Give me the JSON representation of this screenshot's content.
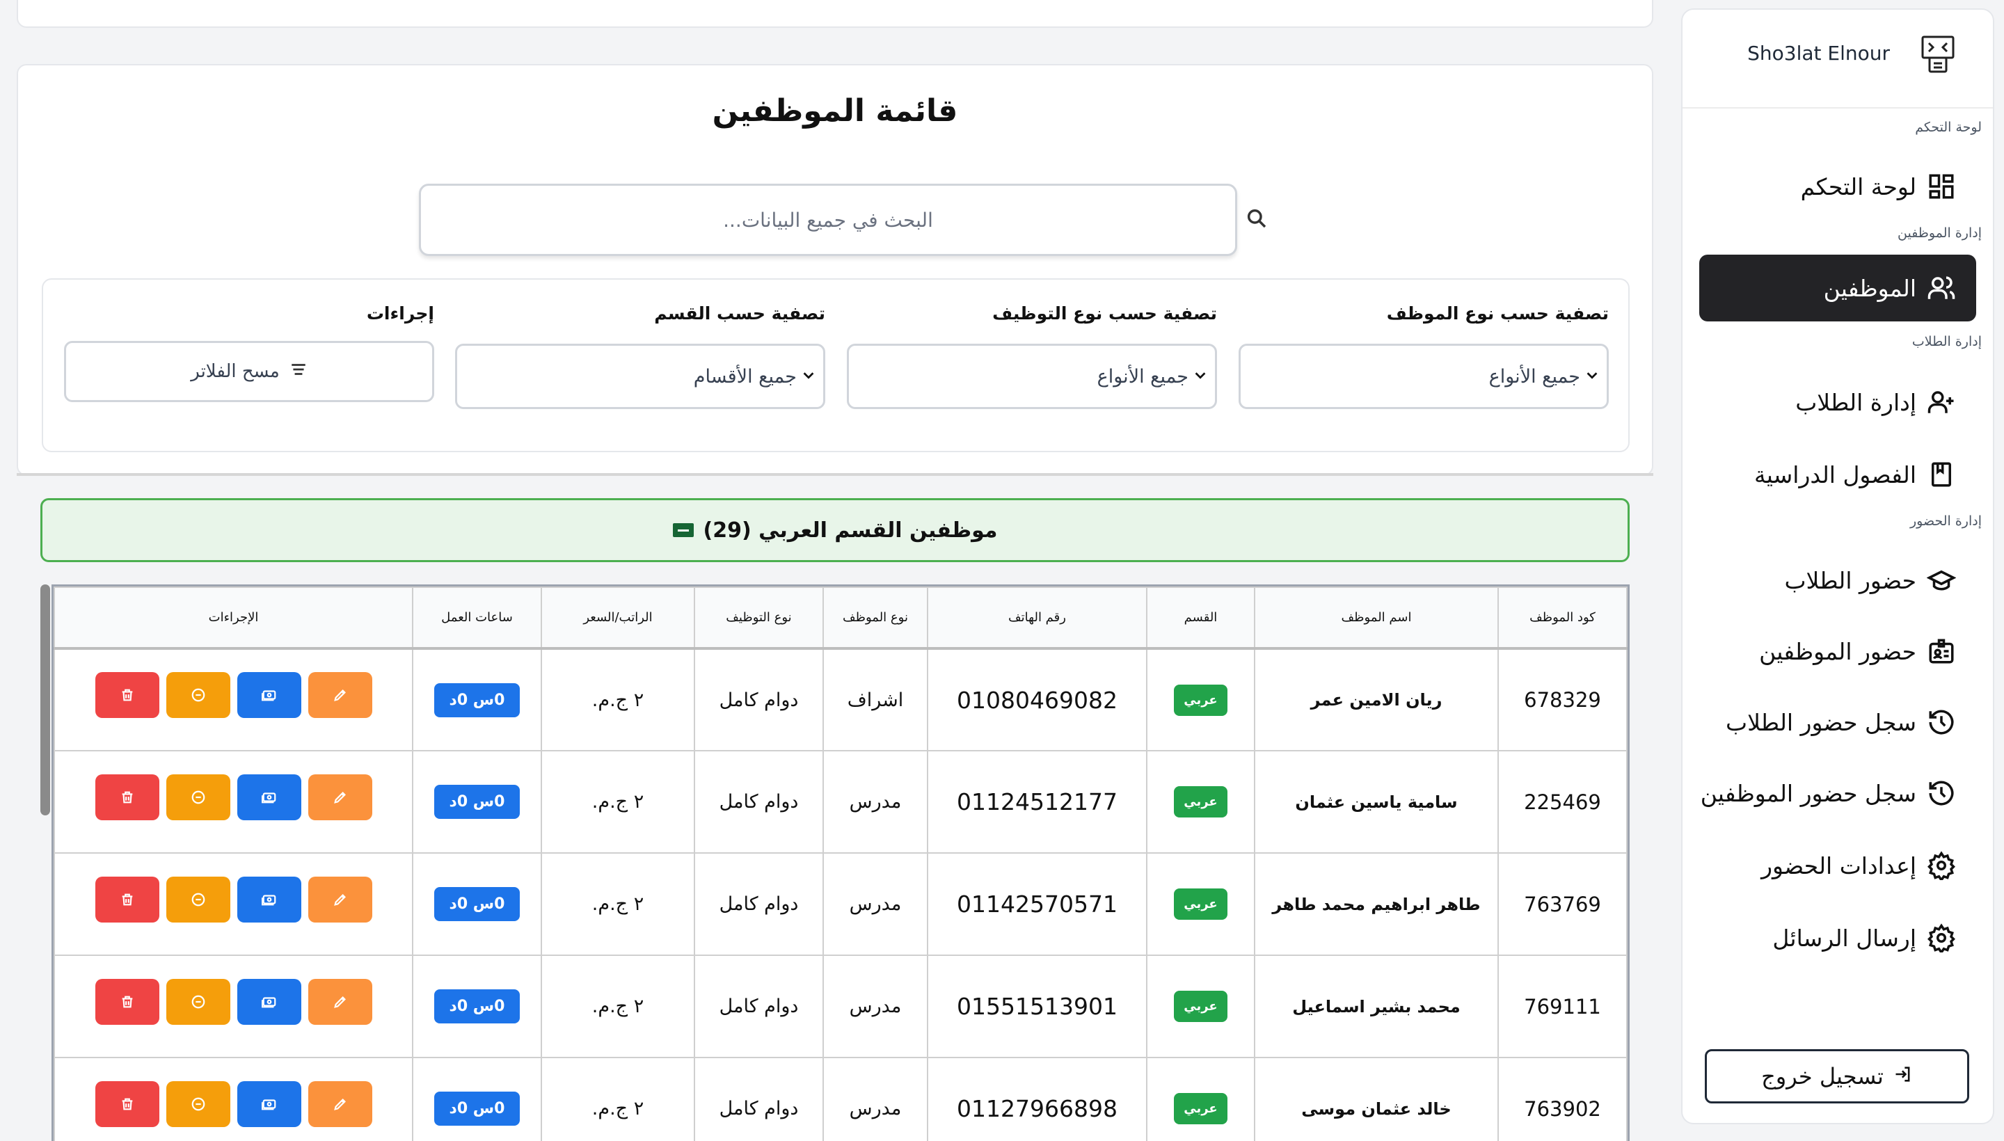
{
  "app": {
    "brand": "Sho3lat Elnour"
  },
  "sidebar": {
    "sections": {
      "dashboard": "لوحة التحكم",
      "employees": "إدارة الموظفين",
      "students": "إدارة الطلاب",
      "attendance": "إدارة الحضور"
    },
    "items": [
      {
        "label": "لوحة التحكم",
        "icon": "dashboard-icon"
      },
      {
        "label": "الموظفين",
        "icon": "users-icon",
        "active": true
      },
      {
        "label": "إدارة الطلاب",
        "icon": "user-plus-icon"
      },
      {
        "label": "الفصول الدراسية",
        "icon": "book-icon"
      },
      {
        "label": "حضور الطلاب",
        "icon": "graduation-cap-icon"
      },
      {
        "label": "حضور الموظفين",
        "icon": "id-badge-icon"
      },
      {
        "label": "سجل حضور الطلاب",
        "icon": "history-icon"
      },
      {
        "label": "سجل حضور الموظفين",
        "icon": "history-icon"
      },
      {
        "label": "إعدادات الحضور",
        "icon": "gear-icon"
      },
      {
        "label": "إرسال الرسائل",
        "icon": "gear-icon"
      }
    ],
    "logout": "تسجيل خروج"
  },
  "main": {
    "title": "قائمة الموظفين",
    "search": {
      "placeholder": "البحث في جميع البيانات..."
    },
    "filters": {
      "employee_type": {
        "label": "تصفية حسب نوع الموظف",
        "value": "جميع الأنواع"
      },
      "employment_type": {
        "label": "تصفية حسب نوع التوظيف",
        "value": "جميع الأنواع"
      },
      "department": {
        "label": "تصفية حسب القسم",
        "value": "جميع الأقسام"
      },
      "actions": {
        "label": "إجراءات",
        "clear": "مسح الفلاتر"
      }
    }
  },
  "section": {
    "title": "موظفين القسم العربي (29)"
  },
  "table": {
    "headers": [
      "كود الموظف",
      "اسم الموظف",
      "القسم",
      "رقم الهاتف",
      "نوع الموظف",
      "نوع التوظيف",
      "الراتب/السعر",
      "ساعات العمل",
      "الإجراءات"
    ],
    "rows": [
      {
        "code": "678329",
        "name": "ريان الامين عمر",
        "dept": "عربي",
        "phone": "01080469082",
        "type": "اشراف",
        "employment": "دوام كامل",
        "salary": "٢ ج.م.",
        "hours": "0س 0د"
      },
      {
        "code": "225469",
        "name": "سامية ياسين عثمان",
        "dept": "عربي",
        "phone": "01124512177",
        "type": "مدرس",
        "employment": "دوام كامل",
        "salary": "٢ ج.م.",
        "hours": "0س 0د"
      },
      {
        "code": "763769",
        "name": "طاهر ابراهيم محمد طاهر",
        "dept": "عربي",
        "phone": "01142570571",
        "type": "مدرس",
        "employment": "دوام كامل",
        "salary": "٢ ج.م.",
        "hours": "0س 0د"
      },
      {
        "code": "769111",
        "name": "محمد بشير اسماعيل",
        "dept": "عربي",
        "phone": "01551513901",
        "type": "مدرس",
        "employment": "دوام كامل",
        "salary": "٢ ج.م.",
        "hours": "0س 0د"
      },
      {
        "code": "763902",
        "name": "خالد عثمان موسى",
        "dept": "عربي",
        "phone": "01127966898",
        "type": "مدرس",
        "employment": "دوام كامل",
        "salary": "٢ ج.م.",
        "hours": "0س 0د"
      }
    ]
  },
  "colors": {
    "active_nav": "#232326",
    "section_border": "#4caf50",
    "section_bg": "#e8f5e9",
    "badge_green": "#22a34a",
    "badge_blue": "#1d74e9",
    "delete_red": "#ef4444",
    "suspend_orange": "#f59e0b",
    "edit_orange": "#fb923c"
  }
}
